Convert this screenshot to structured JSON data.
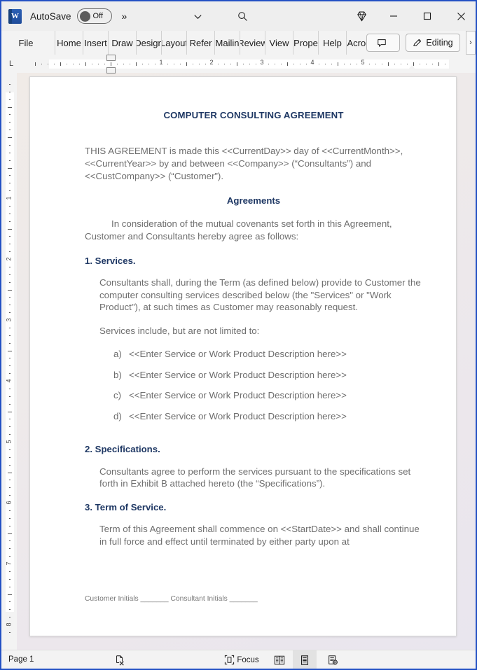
{
  "titlebar": {
    "app_icon": "word-icon",
    "autosave_label": "AutoSave",
    "autosave_state": "Off",
    "more_chevron": "»",
    "chevron_icon": "chevron-down-icon",
    "search_icon": "search-icon",
    "diamond_icon": "diamond-icon",
    "minimize_label": "─",
    "maximize_label": "□",
    "close_label": "✕"
  },
  "ribbon": {
    "tabs": [
      {
        "label": "File",
        "clipped": "File"
      },
      {
        "label": "Home",
        "clipped": "Home"
      },
      {
        "label": "Insert",
        "clipped": "Insert"
      },
      {
        "label": "Draw",
        "clipped": "Draw"
      },
      {
        "label": "Design",
        "clipped": "Design"
      },
      {
        "label": "Layout",
        "clipped": "Layout"
      },
      {
        "label": "References",
        "clipped": "Refer"
      },
      {
        "label": "Mailings",
        "clipped": "Mailin"
      },
      {
        "label": "Review",
        "clipped": "Review"
      },
      {
        "label": "View",
        "clipped": "View"
      },
      {
        "label": "Properties",
        "clipped": "Prope"
      },
      {
        "label": "Help",
        "clipped": "Help"
      },
      {
        "label": "Acrobat",
        "clipped": "Acrob"
      }
    ],
    "comment_button": "",
    "comment_icon": "comment-icon",
    "editing_button": "Editing",
    "editing_icon": "pencil-icon",
    "overflow_chevron": "›"
  },
  "ruler": {
    "tab_stop_selector": "L",
    "horizontal_numbers": [
      "1",
      "2",
      "3",
      "4",
      "5"
    ],
    "vertical_numbers": [
      "1",
      "2",
      "3",
      "4",
      "5",
      "6",
      "7",
      "8"
    ]
  },
  "document": {
    "title": "COMPUTER CONSULTING AGREEMENT",
    "intro": "THIS AGREEMENT is made this <<CurrentDay>> day of <<CurrentMonth>>, <<CurrentYear>> by and between <<Company>> (“Consultants”) and <<CustCompany>> (“Customer”).",
    "agreements_heading": "Agreements",
    "consideration": "In consideration of the mutual covenants set forth in this Agreement, Customer and Consultants hereby agree as follows:",
    "section1_heading": "1. Services.",
    "section1_para": "Consultants shall, during the Term (as defined below) provide to Customer the computer consulting services described below (the \"Services\" or \"Work Product\"), at such times as Customer may reasonably request.",
    "services_include": "Services include, but are not limited to:",
    "service_items": [
      {
        "label": "a)",
        "text": "<<Enter Service or Work Product Description here>>"
      },
      {
        "label": "b)",
        "text": "<<Enter Service or Work Product Description here>>"
      },
      {
        "label": "c)",
        "text": "<<Enter Service or Work Product Description here>>"
      },
      {
        "label": "d)",
        "text": "<<Enter Service or Work Product Description here>>"
      }
    ],
    "section2_heading": "2. Specifications.",
    "section2_para": "Consultants agree to perform the services pursuant to the specifications set forth in Exhibit B attached hereto (the “Specifications”).",
    "section3_heading": "3. Term of Service.",
    "section3_para": "Term of this Agreement shall commence on <<StartDate>> and shall continue in full force and effect until terminated by either party upon at",
    "footer_initials": "Customer Initials   _______ Consultant Initials _______"
  },
  "statusbar": {
    "page_label": "Page 1",
    "proofing_icon": "spelling-check-icon",
    "focus_label": "Focus",
    "focus_icon": "focus-icon",
    "read_mode_icon": "read-mode-icon",
    "print_layout_icon": "print-layout-icon",
    "web_layout_icon": "web-layout-icon"
  },
  "colors": {
    "window_border": "#2351c4",
    "heading": "#1f3864",
    "body_text": "#6e6e6e",
    "chrome": "#f3f3f3",
    "titlebar": "#eeeeee"
  }
}
